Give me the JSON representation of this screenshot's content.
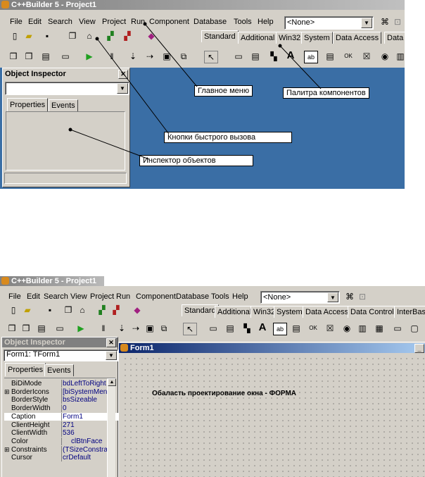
{
  "top": {
    "window_title": "C++Builder 5 - Project1",
    "menu": [
      "File",
      "Edit",
      "Search",
      "View",
      "Project",
      "Run",
      "Component",
      "Database",
      "Tools",
      "Help"
    ],
    "config_combo": "<None>",
    "palette_tabs": [
      "Standard",
      "Additional",
      "Win32",
      "System",
      "Data Access",
      "Data"
    ],
    "inspector": {
      "title": "Object Inspector",
      "tabs": [
        "Properties",
        "Events"
      ]
    },
    "callouts": {
      "main_menu": "Главное меню",
      "palette": "Палитра компонентов",
      "speedbuttons": "Кнопки быстрого вызова",
      "inspector": "Инспектор объектов"
    }
  },
  "bottom": {
    "window_title": "C++Builder 5 - Project1",
    "menu": [
      "File",
      "Edit",
      "Search",
      "View",
      "Project",
      "Run",
      "Component",
      "Database",
      "Tools",
      "Help"
    ],
    "config_combo": "<None>",
    "palette_tabs": [
      "Standard",
      "Additional",
      "Win32",
      "System",
      "Data Access",
      "Data Controls",
      "InterBase"
    ],
    "inspector": {
      "title": "Object Inspector",
      "object_combo": "Form1: TForm1",
      "tabs": [
        "Properties",
        "Events"
      ],
      "properties": [
        {
          "name": "BiDiMode",
          "value": "bdLeftToRight",
          "expand": ""
        },
        {
          "name": "BorderIcons",
          "value": "[biSystemMenu",
          "expand": "⊞"
        },
        {
          "name": "BorderStyle",
          "value": "bsSizeable",
          "expand": ""
        },
        {
          "name": "BorderWidth",
          "value": "0",
          "expand": ""
        },
        {
          "name": "Caption",
          "value": "Form1",
          "expand": ""
        },
        {
          "name": "ClientHeight",
          "value": "271",
          "expand": ""
        },
        {
          "name": "ClientWidth",
          "value": "536",
          "expand": ""
        },
        {
          "name": "Color",
          "value": "clBtnFace",
          "expand": ""
        },
        {
          "name": "Constraints",
          "value": "(TSizeConstrain",
          "expand": "⊞"
        },
        {
          "name": "Cursor",
          "value": "crDefault",
          "expand": ""
        }
      ]
    },
    "form": {
      "title": "Form1",
      "annotation": "Обаласть проектирование окна - ФОРМА"
    }
  },
  "colors": {
    "titlebar_active": "#0a246a",
    "titlebar_inactive": "#808080",
    "desktop_blue": "#3a6ea5",
    "face": "#d4d0c8"
  }
}
